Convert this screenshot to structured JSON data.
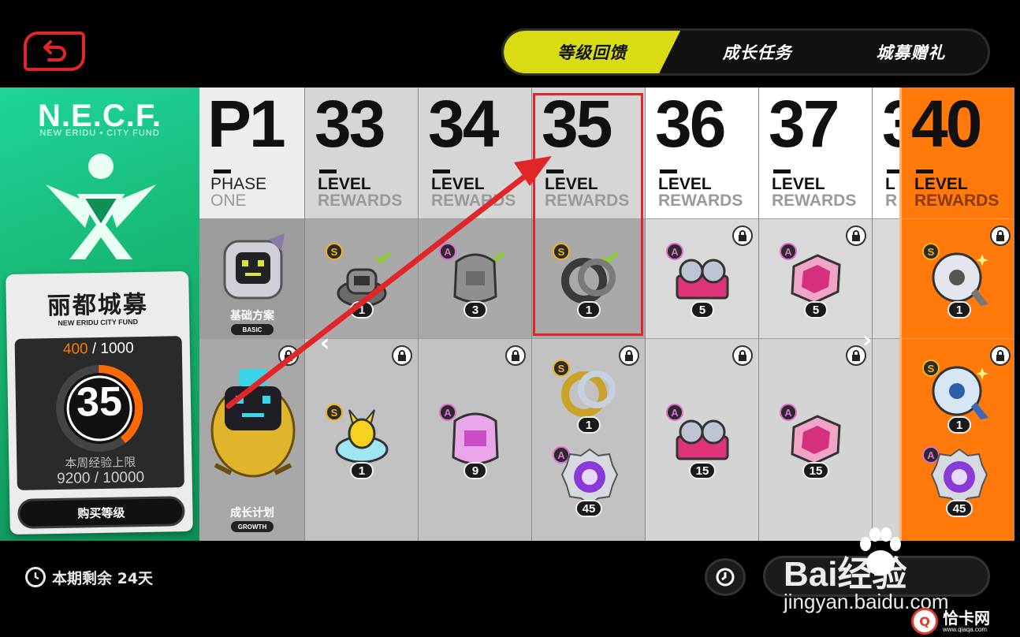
{
  "tabs": [
    {
      "label": "等级回馈",
      "active": true
    },
    {
      "label": "成长任务",
      "active": false
    },
    {
      "label": "城募赠礼",
      "active": false
    }
  ],
  "fund": {
    "logo_title": "N.E.C.F.",
    "logo_subtitle": "NEW ERIDU • CITY FUND",
    "name": "丽都城募",
    "name_sub": "NEW ERIDU CITY FUND",
    "xp_current": "400",
    "xp_total": "/ 1000",
    "xp_progress": 0.4,
    "level": "35",
    "weekly_label": "本周经验上限",
    "weekly_value": "9200 / 10000",
    "buy_label": "购买等级"
  },
  "phase": {
    "number": "P1",
    "line1": "PHASE",
    "line2": "ONE",
    "basic_label": "基础方案",
    "basic_sub": "BASIC",
    "growth_label": "成长计划",
    "growth_sub": "GROWTH"
  },
  "levels": [
    {
      "number": "33",
      "line1": "LEVEL",
      "line2": "REWARDS",
      "basic": {
        "rank": "S",
        "qty": "1",
        "claimed": true,
        "locked": false
      },
      "growth": [
        {
          "rank": "S",
          "qty": "1",
          "locked": true
        }
      ]
    },
    {
      "number": "34",
      "line1": "LEVEL",
      "line2": "REWARDS",
      "basic": {
        "rank": "A",
        "qty": "3",
        "claimed": true,
        "locked": false
      },
      "growth": [
        {
          "rank": "A",
          "qty": "9",
          "locked": true
        }
      ]
    },
    {
      "number": "35",
      "line1": "LEVEL",
      "line2": "REWARDS",
      "basic": {
        "rank": "S",
        "qty": "1",
        "claimed": true,
        "locked": false
      },
      "growth": [
        {
          "rank": "S",
          "qty": "1",
          "locked": true
        },
        {
          "rank": "A",
          "qty": "45",
          "locked": true
        }
      ]
    },
    {
      "number": "36",
      "line1": "LEVEL",
      "line2": "REWARDS",
      "basic": {
        "rank": "A",
        "qty": "5",
        "claimed": false,
        "locked": true
      },
      "growth": [
        {
          "rank": "A",
          "qty": "15",
          "locked": true
        }
      ]
    },
    {
      "number": "37",
      "line1": "LEVEL",
      "line2": "REWARDS",
      "basic": {
        "rank": "A",
        "qty": "5",
        "claimed": false,
        "locked": true
      },
      "growth": [
        {
          "rank": "A",
          "qty": "15",
          "locked": true
        }
      ]
    },
    {
      "number": "3",
      "line1": "L",
      "line2": "R"
    },
    {
      "number": "40",
      "line1": "LEVEL",
      "line2": "REWARDS",
      "basic": {
        "rank": "S",
        "qty": "1",
        "claimed": false,
        "locked": true
      },
      "growth": [
        {
          "rank": "S",
          "qty": "1",
          "locked": true
        },
        {
          "rank": "A",
          "qty": "45",
          "locked": true
        }
      ]
    }
  ],
  "footer": {
    "remaining": "本期剩余 24天"
  },
  "watermark": {
    "baidu": "Bai经验",
    "baidu_url": "jingyan.baidu.com",
    "qiaka": "恰卡网",
    "qiaka_url": "www.qiaqa.com"
  },
  "colors": {
    "accent_tab": "#d9dc13",
    "green_panel": "#17b673",
    "orange_highlight": "#ff7a0a",
    "annotation_red": "#e1262a"
  }
}
